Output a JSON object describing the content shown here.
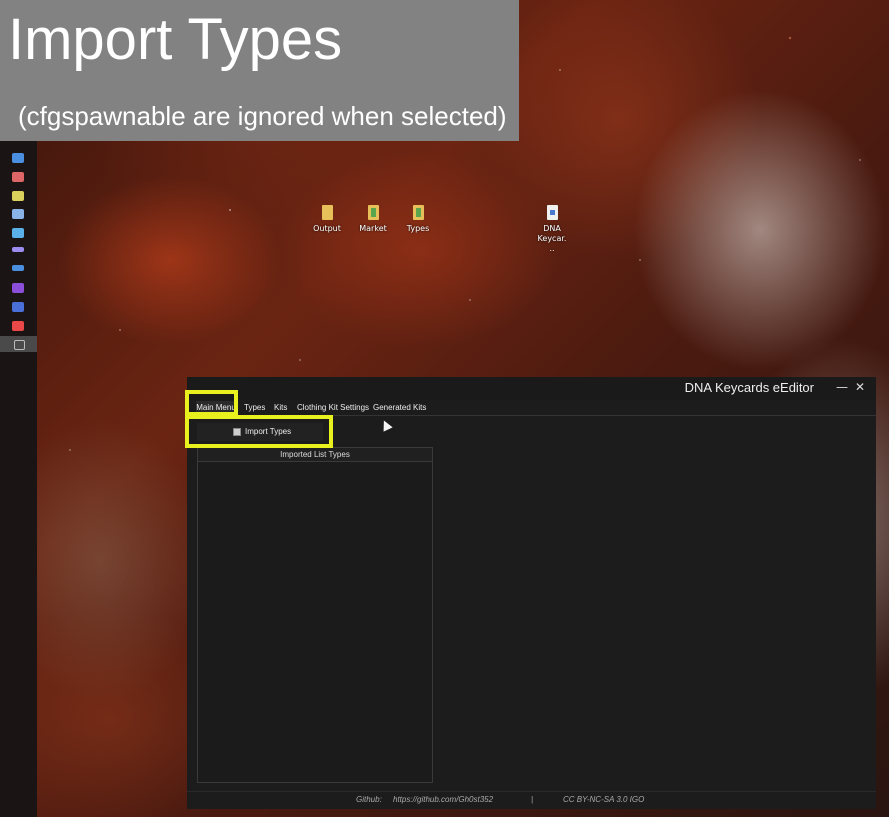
{
  "caption": {
    "title": "Import Types",
    "subtitle": "(cfgspawnable are ignored when selected)"
  },
  "taskbar": {
    "items": [
      {
        "icon": "outlook-icon",
        "color": "#4a8fe0"
      },
      {
        "icon": "paint-icon",
        "color": "#d66"
      },
      {
        "icon": "notepad-icon",
        "color": "#d9d15c"
      },
      {
        "icon": "explorer-icon",
        "color": "#8ab3e8"
      },
      {
        "icon": "store-icon",
        "color": "#5ab0e8"
      },
      {
        "icon": "terminal-icon",
        "color": "#9c8cf0"
      },
      {
        "icon": "steam-icon",
        "color": "#4a8fe0"
      },
      {
        "icon": "visual-studio-icon",
        "color": "#8a4ed8"
      },
      {
        "icon": "remote-desktop-icon",
        "color": "#4a6fd8"
      },
      {
        "icon": "game-icon",
        "color": "#e84848"
      },
      {
        "icon": "app-icon",
        "color": "#bbb"
      }
    ]
  },
  "desktop": {
    "icons": [
      {
        "label": "Output",
        "type": "folder"
      },
      {
        "label": "Market",
        "type": "folder"
      },
      {
        "label": "Types",
        "type": "folder"
      },
      {
        "label": "DNA Keycar...",
        "type": "file"
      }
    ]
  },
  "app": {
    "title": "DNA Keycards eEditor",
    "minimize": "—",
    "close": "✕",
    "tabs": [
      "Main Menu",
      "Types",
      "Kits",
      "Clothing Kit Settings",
      "Generated Kits"
    ],
    "import_button": "Import Types",
    "list_header": "Imported List Types",
    "status": {
      "github_label": "Github:",
      "github_url": "https://github.com/Gh0st352",
      "separator": "|",
      "license": "CC BY-NC-SA 3.0 IGO"
    }
  },
  "colors": {
    "highlight": "#e8f01e",
    "window_bg": "#1c1c1c",
    "caption_bg": "#828282"
  }
}
